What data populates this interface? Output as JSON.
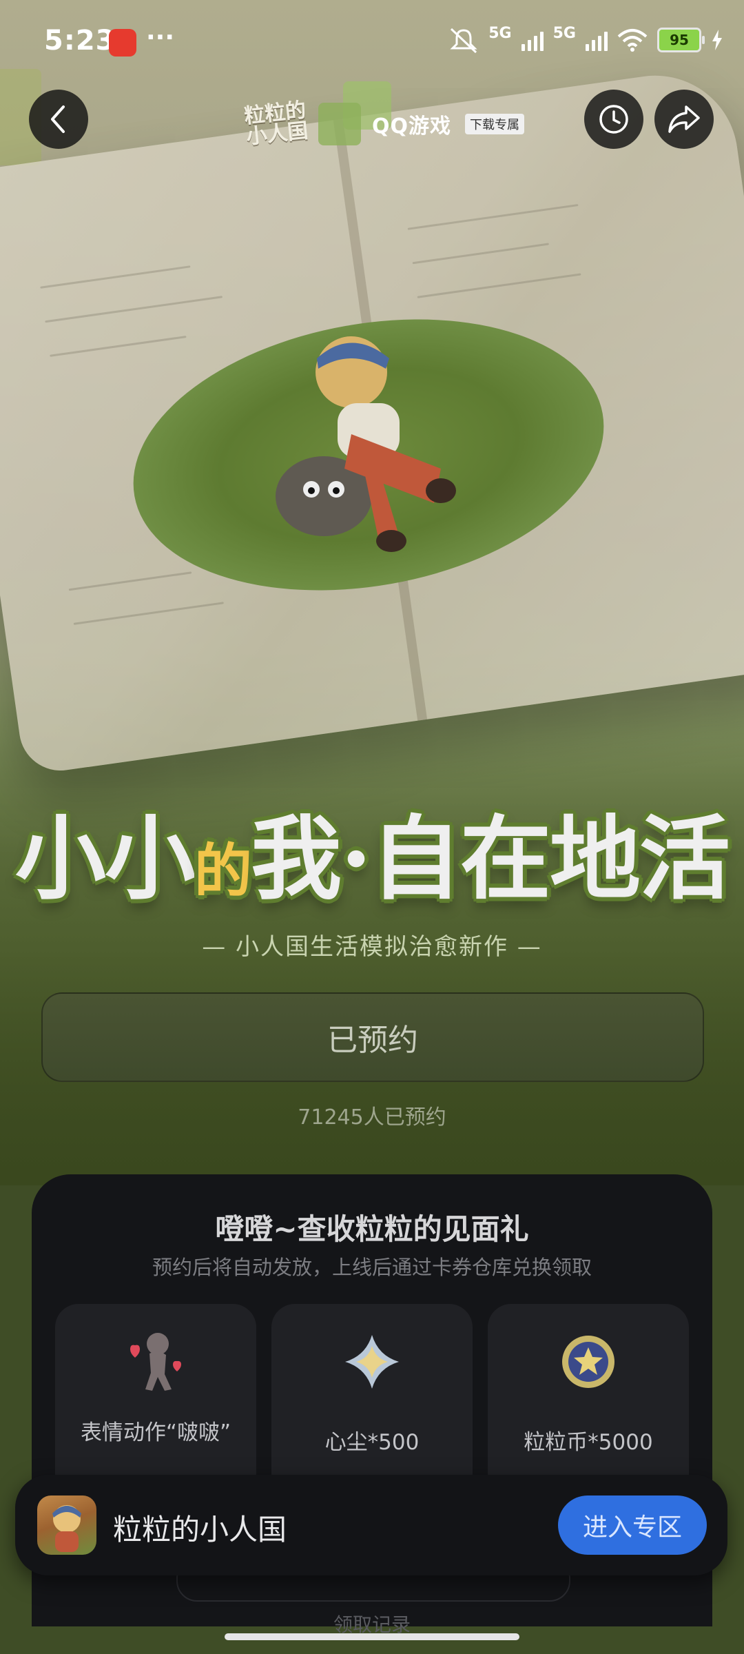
{
  "status_bar": {
    "time": "5:23",
    "more": "···",
    "network_1": "5G",
    "network_2": "5G",
    "battery": "95"
  },
  "header": {
    "logo_text": "粒粒的小人国",
    "platform": "QQ游戏",
    "platform_tag": "下载专属"
  },
  "hero": {
    "slogan_part1": "小小",
    "slogan_highlight": "的",
    "slogan_part2": "我·自在地活",
    "subtitle": "— 小人国生活模拟治愈新作 —",
    "reserve_button": "已预约",
    "reserve_count": "71245人已预约"
  },
  "gifts": {
    "title": "噔噔~查收粒粒的见面礼",
    "subtitle": "预约后将自动发放，上线后通过卡券仓库兑换领取",
    "items": [
      {
        "label": "表情动作“啵啵”",
        "icon": "emote-figure-icon"
      },
      {
        "label": "心尘*500",
        "icon": "heart-dust-crystal-icon"
      },
      {
        "label": "粒粒币*5000",
        "icon": "coin-icon"
      }
    ],
    "record_link": "领取记录"
  },
  "bottom_bar": {
    "game_name": "粒粒的小人国",
    "enter_button": "进入专区"
  },
  "colors": {
    "accent_blue": "#2f6fe0",
    "panel_bg": "#141518",
    "title_outline_green": "#5f7d2f"
  }
}
